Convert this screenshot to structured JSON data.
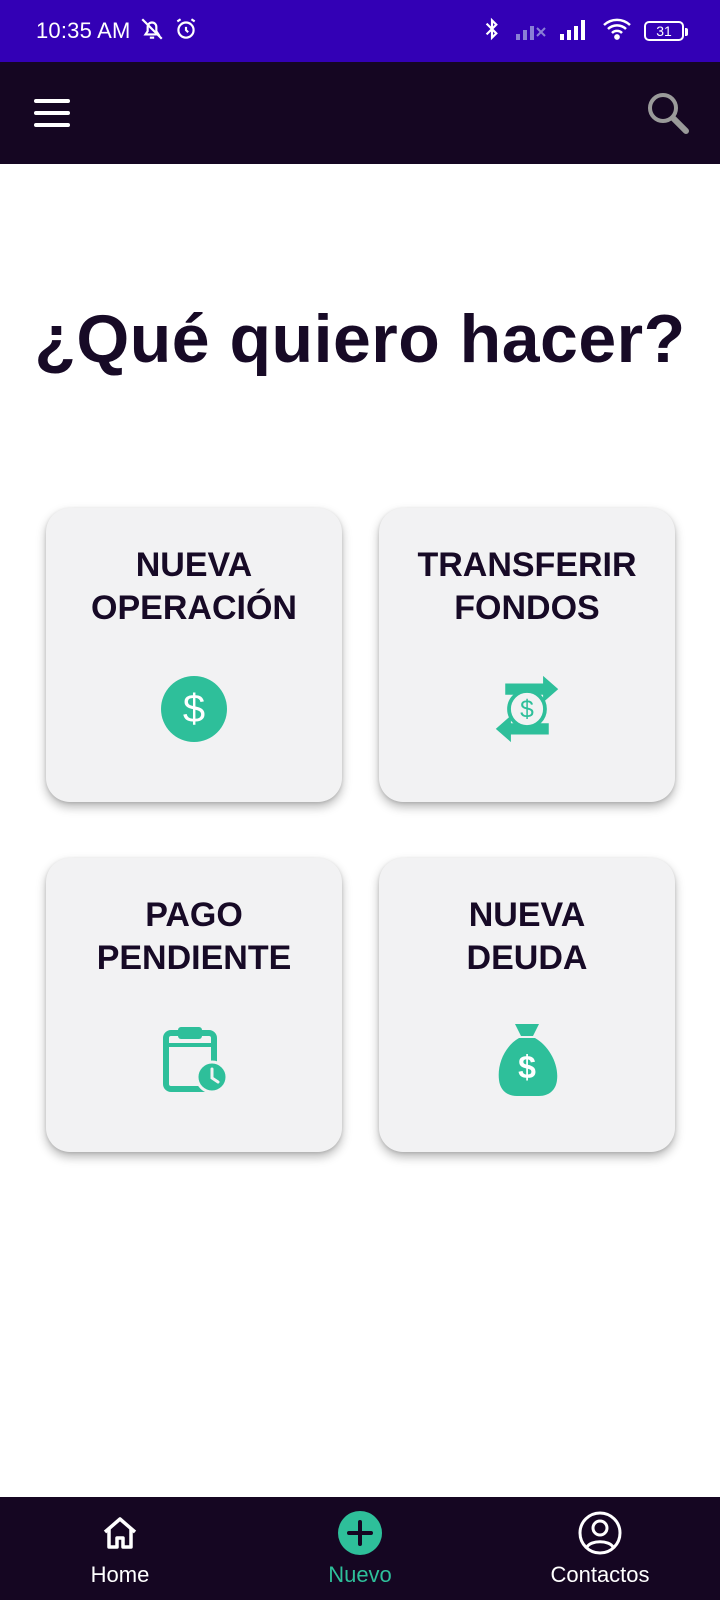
{
  "status_bar": {
    "time": "10:35 AM",
    "battery": "31",
    "icons": [
      "muted-bell-icon",
      "alarm-icon",
      "bluetooth-icon",
      "signal-off-icon",
      "signal-icon",
      "wifi-icon",
      "battery-icon"
    ]
  },
  "app_bar": {
    "menu_icon": "hamburger-menu-icon",
    "search_icon": "search-icon"
  },
  "page": {
    "title": "¿Qué quiero hacer?"
  },
  "cards": [
    {
      "label": "NUEVA\nOPERACIÓN",
      "icon": "dollar-circle-icon"
    },
    {
      "label": "TRANSFERIR\nFONDOS",
      "icon": "transfer-money-icon"
    },
    {
      "label": "PAGO\nPENDIENTE",
      "icon": "clipboard-clock-icon"
    },
    {
      "label": "NUEVA\nDEUDA",
      "icon": "money-bag-icon"
    }
  ],
  "bottom_nav": {
    "items": [
      {
        "label": "Home",
        "icon": "home-icon",
        "active": false
      },
      {
        "label": "Nuevo",
        "icon": "add-circle-icon",
        "active": true
      },
      {
        "label": "Contactos",
        "icon": "account-circle-icon",
        "active": false
      }
    ]
  },
  "colors": {
    "status_bar": "#3300b5",
    "app_bar": "#150622",
    "accent": "#2ebf9a",
    "card_bg": "#f2f2f3",
    "text_dark": "#170a26"
  }
}
